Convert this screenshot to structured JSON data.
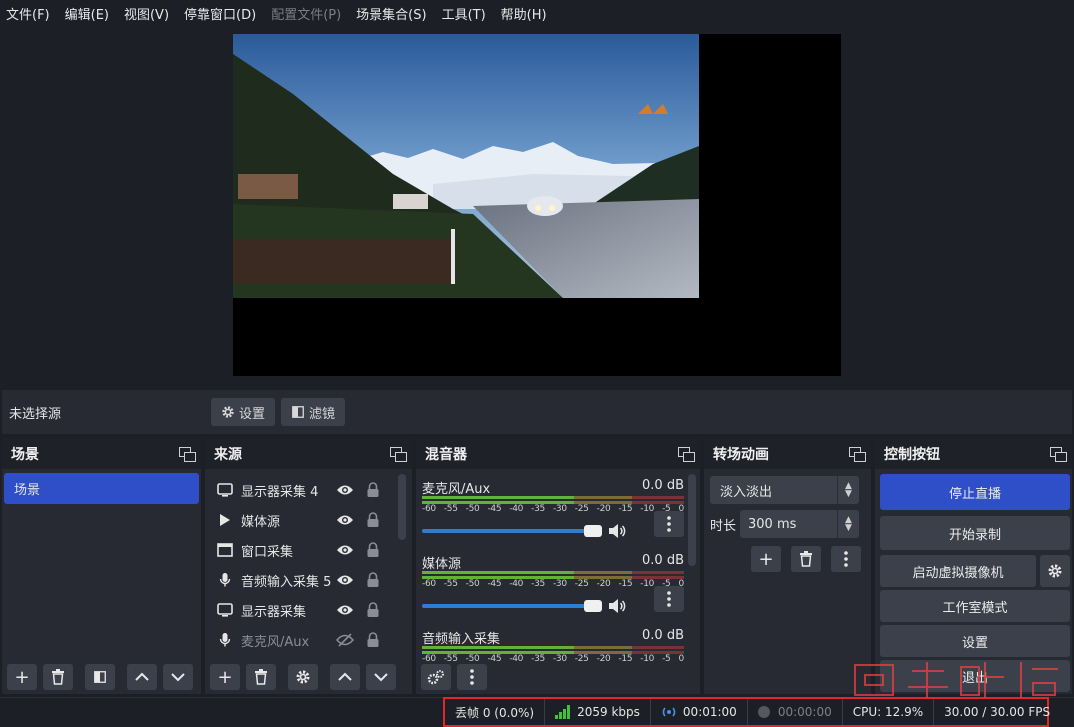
{
  "menu": [
    {
      "label": "文件(F)",
      "enabled": true
    },
    {
      "label": "编辑(E)",
      "enabled": true
    },
    {
      "label": "视图(V)",
      "enabled": true
    },
    {
      "label": "停靠窗口(D)",
      "enabled": true
    },
    {
      "label": "配置文件(P)",
      "enabled": false
    },
    {
      "label": "场景集合(S)",
      "enabled": true
    },
    {
      "label": "工具(T)",
      "enabled": true
    },
    {
      "label": "帮助(H)",
      "enabled": true
    }
  ],
  "source_bar": {
    "no_source": "未选择源",
    "settings_label": "设置",
    "filters_label": "滤镜"
  },
  "scenes": {
    "title": "场景",
    "items": [
      "场景"
    ]
  },
  "sources": {
    "title": "来源",
    "items": [
      {
        "label": "显示器采集 4",
        "icon": "monitor-icon",
        "visible": true,
        "locked": true
      },
      {
        "label": "媒体源",
        "icon": "play-icon",
        "visible": true,
        "locked": true
      },
      {
        "label": "窗口采集",
        "icon": "window-icon",
        "visible": true,
        "locked": true
      },
      {
        "label": "音频输入采集 5",
        "icon": "microphone-icon",
        "visible": true,
        "locked": true
      },
      {
        "label": "显示器采集",
        "icon": "monitor-icon",
        "visible": true,
        "locked": true
      },
      {
        "label": "麦克风/Aux",
        "icon": "microphone-icon",
        "visible": false,
        "locked": true
      }
    ]
  },
  "mixer": {
    "title": "混音器",
    "ticks": [
      "-60",
      "-55",
      "-50",
      "-45",
      "-40",
      "-35",
      "-30",
      "-25",
      "-20",
      "-15",
      "-10",
      "-5",
      "0"
    ],
    "channels": [
      {
        "name": "麦克风/Aux",
        "level": "0.0 dB",
        "volume": 1.0
      },
      {
        "name": "媒体源",
        "level": "0.0 dB",
        "volume": 1.0
      },
      {
        "name": "音频输入采集",
        "level": "0.0 dB",
        "volume": 1.0
      }
    ]
  },
  "transitions": {
    "title": "转场动画",
    "selected": "淡入淡出",
    "duration_label": "时长",
    "duration_value": "300 ms"
  },
  "controls": {
    "title": "控制按钮",
    "stop_stream": "停止直播",
    "start_record": "开始录制",
    "virtual_cam": "启动虚拟摄像机",
    "studio_mode": "工作室模式",
    "settings": "设置",
    "exit": "退出"
  },
  "status": {
    "dropped": "丢帧 0 (0.0%)",
    "bitrate": "2059 kbps",
    "stream_time": "00:01:00",
    "record_time": "00:00:00",
    "cpu": "CPU: 12.9%",
    "fps": "30.00 / 30.00 FPS"
  },
  "colors": {
    "accent": "#2e4fc7",
    "highlight_frame": "#e0282a",
    "meter_green": "#5fb23a",
    "meter_yellow": "#c7a23a",
    "meter_red": "#c0393b"
  }
}
